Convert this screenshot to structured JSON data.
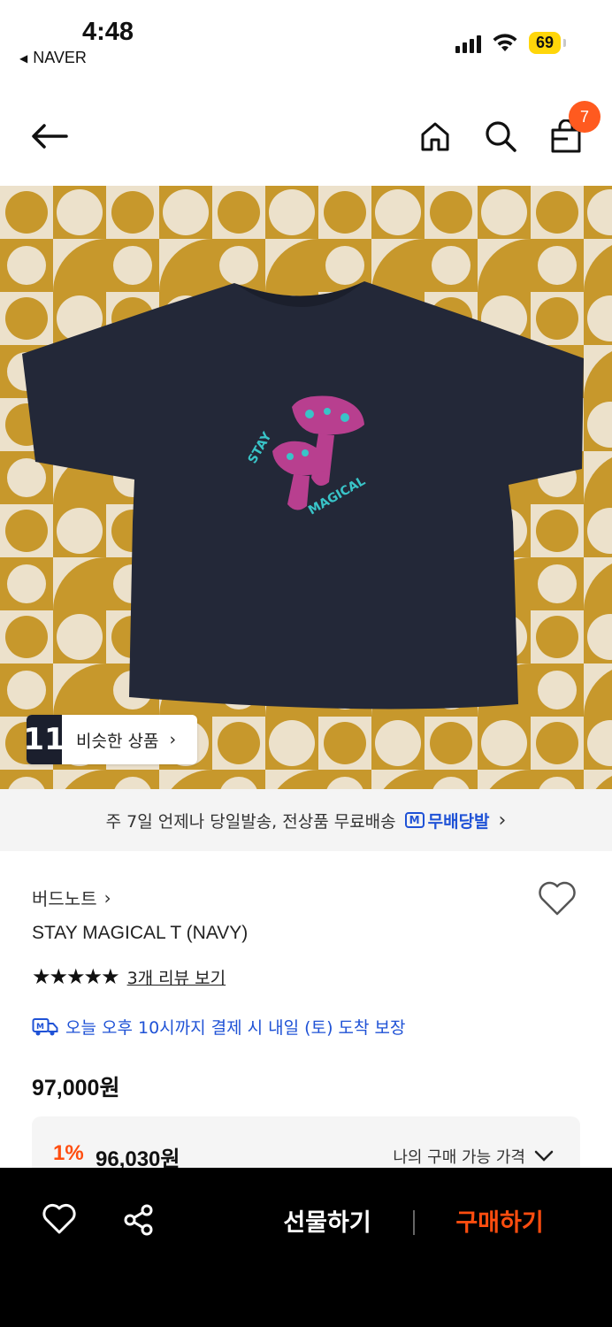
{
  "status_bar": {
    "time": "4:48",
    "back_app": "NAVER",
    "battery": "69"
  },
  "nav": {
    "cart_count": "7"
  },
  "product_image": {
    "shirt_text_top": "STAY",
    "shirt_text_bottom": "MAGICAL",
    "similar_button_label": "비슷한 상품",
    "similar_thumb_text": "11"
  },
  "delivery_banner": {
    "text": "주 7일 언제나 당일발송, 전상품 무료배송",
    "badge_icon_text": "M",
    "badge_label": "무배당발"
  },
  "product": {
    "brand": "버드노트",
    "name": "STAY MAGICAL T (NAVY)",
    "stars": "★★★★★",
    "review_link": "3개 리뷰 보기",
    "arrival_guarantee": "오늘 오후 10시까지 결제 시 내일 (토) 도착 보장",
    "price": "97,000원",
    "discount": "1%",
    "my_price": "96,030원",
    "my_price_label": "나의 구매 가능 가격"
  },
  "bottom_bar": {
    "gift_label": "선물하기",
    "buy_label": "구매하기"
  },
  "colors": {
    "accent_orange": "#ff4d0f",
    "accent_blue": "#1f52d6",
    "battery_yellow": "#ffd60a"
  }
}
